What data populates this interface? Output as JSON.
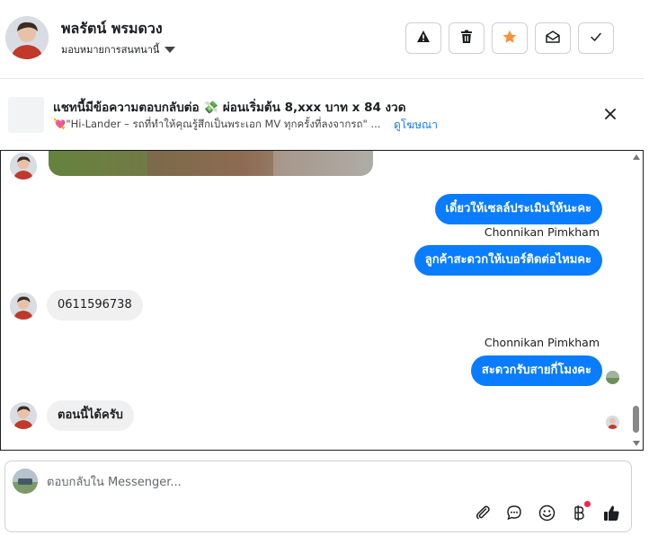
{
  "header": {
    "contact_name": "พลรัตน์ พรมดวง",
    "assign_label": "มอบหมายการสนทนานี้"
  },
  "ad": {
    "title": "แชทนี้มีข้อความตอบกลับต่อ 💸 ผ่อนเริ่มต้น 8,xxx บาท x 84 งวด",
    "subtitle": "💘\"Hi-Lander – รถที่ทำให้คุณรู้สึกเป็นพระเอก MV ทุกครั้งที่ลงจากรถ\" ...",
    "link_label": "ดูโฆษณา"
  },
  "messages": [
    {
      "type": "outgoing",
      "text": "เดี๋ยวให้เซลล์ประเมินให้นะคะ"
    },
    {
      "type": "sender",
      "text": "Chonnikan Pimkham"
    },
    {
      "type": "outgoing",
      "text": "ลูกค้าสะดวกให้เบอร์ติดต่อไหมคะ"
    },
    {
      "type": "incoming",
      "text": "0611596738"
    },
    {
      "type": "sender",
      "text": "Chonnikan Pimkham"
    },
    {
      "type": "outgoing",
      "text": "สะดวกรับสายกี่โมงคะ"
    },
    {
      "type": "incoming",
      "text": "ตอนนี้ได้ครับ"
    }
  ],
  "composer": {
    "placeholder": "ตอบกลับใน Messenger..."
  },
  "icons": {
    "report": "warning-icon",
    "delete": "trash-icon",
    "star": "star-icon",
    "mark_unread": "envelope-open-icon",
    "done": "check-icon",
    "close": "close-icon",
    "attach": "paperclip-icon",
    "saved_reply": "chat-bubble-icon",
    "emoji": "smiley-icon",
    "payment": "baht-icon",
    "like": "thumbs-up-icon"
  },
  "colors": {
    "accent": "#0a7cff",
    "star": "#f7923b",
    "notify": "#f02849"
  }
}
